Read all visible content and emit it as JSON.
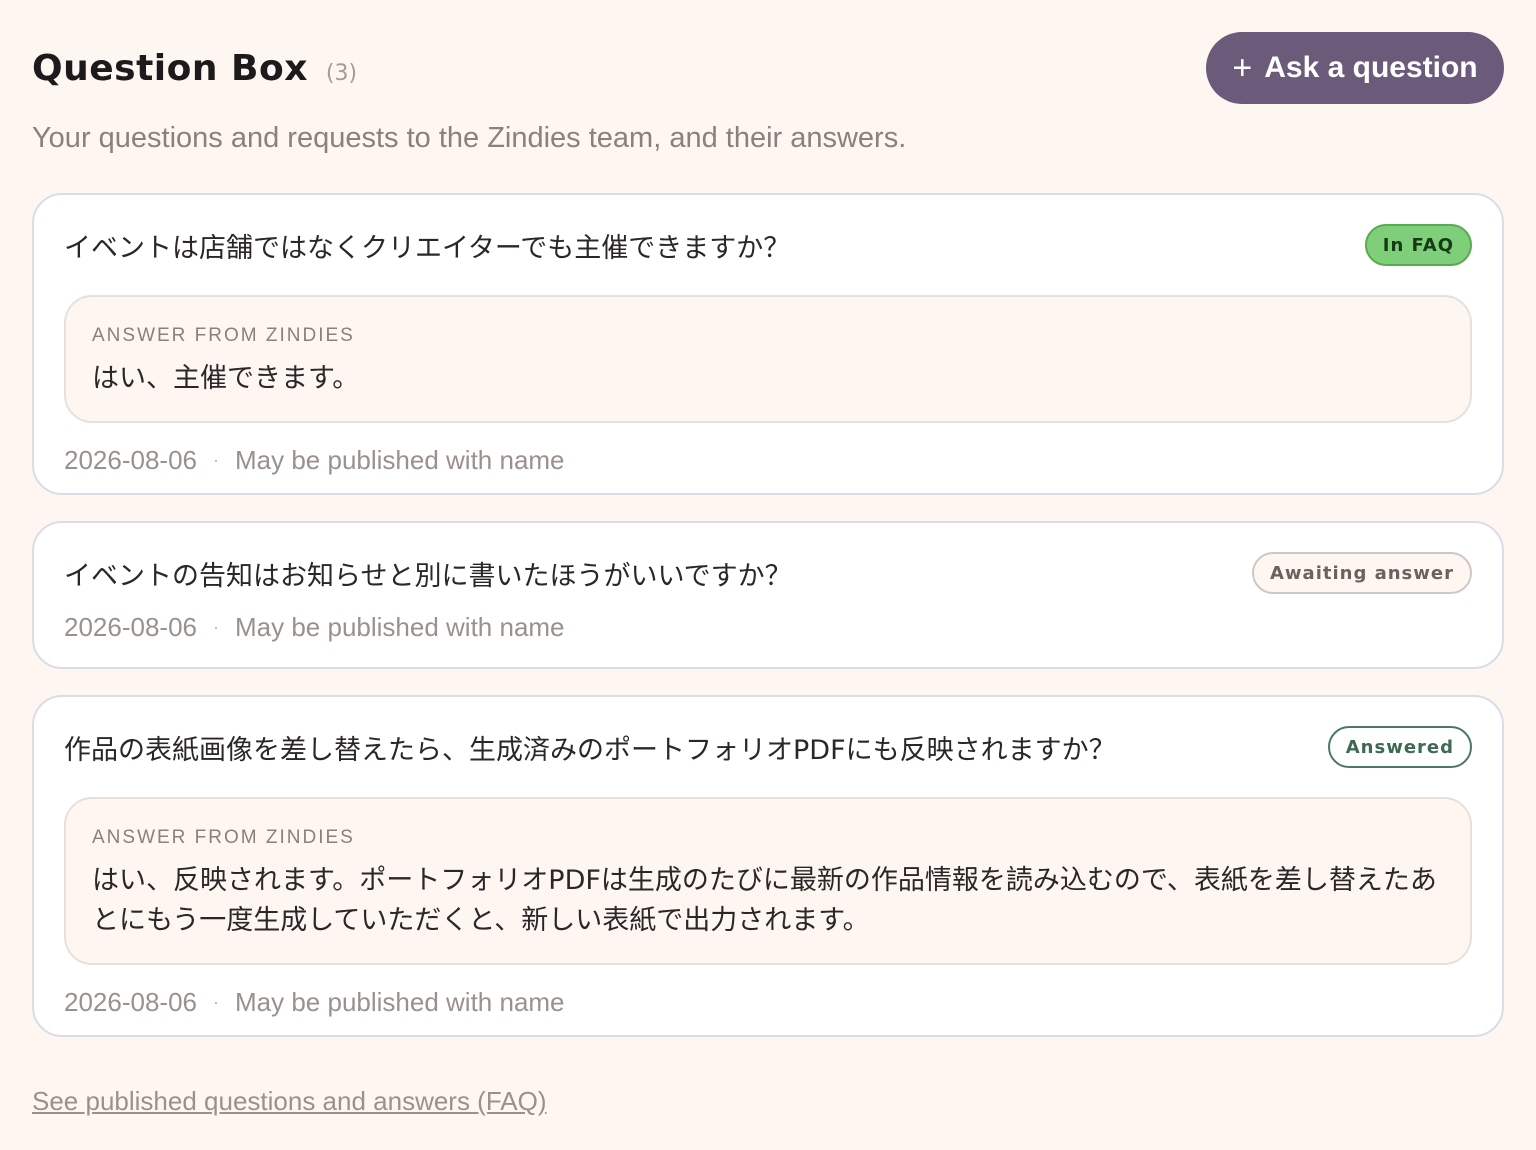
{
  "header": {
    "title": "Question Box",
    "count": "(3)",
    "ask_button": "Ask a question",
    "ask_icon": "plus-icon"
  },
  "subtitle": "Your questions and requests to the Zindies team, and their answers.",
  "questions": [
    {
      "question": "イベントは店舗ではなくクリエイターでも主催できますか？",
      "status": "In FAQ",
      "answer_label": "ANSWER FROM ZINDIES",
      "answer": "はい、主催できます。",
      "date": "2026-08-06",
      "separator": "·",
      "publish_note": "May be published with name"
    },
    {
      "question": "イベントの告知はお知らせと別に書いたほうがいいですか？",
      "status": "Awaiting answer",
      "date": "2026-08-06",
      "separator": "·",
      "publish_note": "May be published with name"
    },
    {
      "question": "作品の表紙画像を差し替えたら、生成済みのポートフォリオPDFにも反映されますか？",
      "status": "Answered",
      "answer_label": "ANSWER FROM ZINDIES",
      "answer": "はい、反映されます。ポートフォリオPDFは生成のたびに最新の作品情報を読み込むので、表紙を差し替えたあとにもう一度生成していただくと、新しい表紙で出力されます。",
      "date": "2026-08-06",
      "separator": "·",
      "publish_note": "May be published with name"
    }
  ],
  "faq_link": "See published questions and answers (FAQ)",
  "colors": {
    "background": "#fdf6f1",
    "accent": "#6c5a7b",
    "faq_badge": "#7fcf7a",
    "answered_badge": "#4b7a62"
  }
}
